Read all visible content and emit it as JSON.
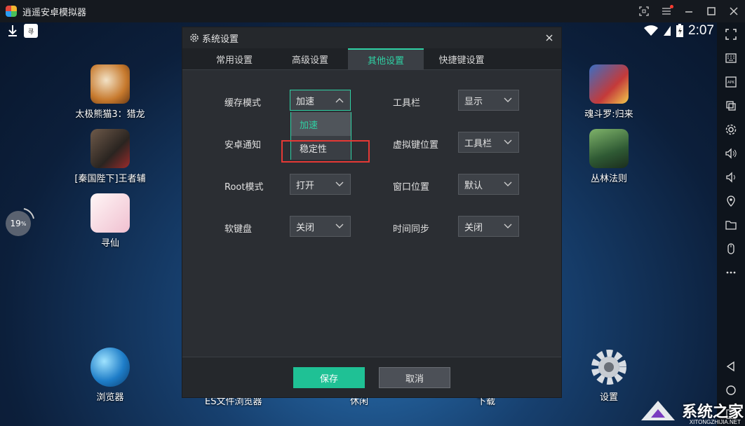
{
  "window": {
    "title": "逍遥安卓模拟器"
  },
  "status": {
    "time": "2:07"
  },
  "progress": {
    "value": "19",
    "unit": "%"
  },
  "desktop": {
    "left_icons": [
      {
        "label": "太极熊猫3：猎龙"
      },
      {
        "label": "[秦国陛下]王者辅"
      },
      {
        "label": "寻仙"
      }
    ],
    "right_icons": [
      {
        "label": "魂斗罗:归来"
      },
      {
        "label": "丛林法则"
      }
    ],
    "bottom_icons": [
      {
        "label": "浏览器"
      },
      {
        "label": "ES文件浏览器"
      },
      {
        "label": "休闲"
      },
      {
        "label": "下载"
      },
      {
        "label": "设置"
      }
    ]
  },
  "dialog": {
    "title": "系统设置",
    "tabs": [
      "常用设置",
      "高级设置",
      "其他设置",
      "快捷键设置"
    ],
    "active_tab_index": 2,
    "left_settings": [
      {
        "label": "缓存模式",
        "value": "加速"
      },
      {
        "label": "安卓通知",
        "value": ""
      },
      {
        "label": "Root模式",
        "value": "打开"
      },
      {
        "label": "软键盘",
        "value": "关闭"
      }
    ],
    "right_settings": [
      {
        "label": "工具栏",
        "value": "显示"
      },
      {
        "label": "虚拟键位置",
        "value": "工具栏"
      },
      {
        "label": "窗口位置",
        "value": "默认"
      },
      {
        "label": "时间同步",
        "value": "关闭"
      }
    ],
    "dropdown_options": [
      "加速",
      "稳定性"
    ],
    "save_label": "保存",
    "cancel_label": "取消"
  },
  "watermark": {
    "text": "系统之家",
    "sub": "XITONGZHIJIA.NET"
  },
  "colors": {
    "accent": "#2fd1a4",
    "save_button": "#1fc195",
    "highlight_box": "#e53935",
    "titlebar": "#15191f"
  }
}
